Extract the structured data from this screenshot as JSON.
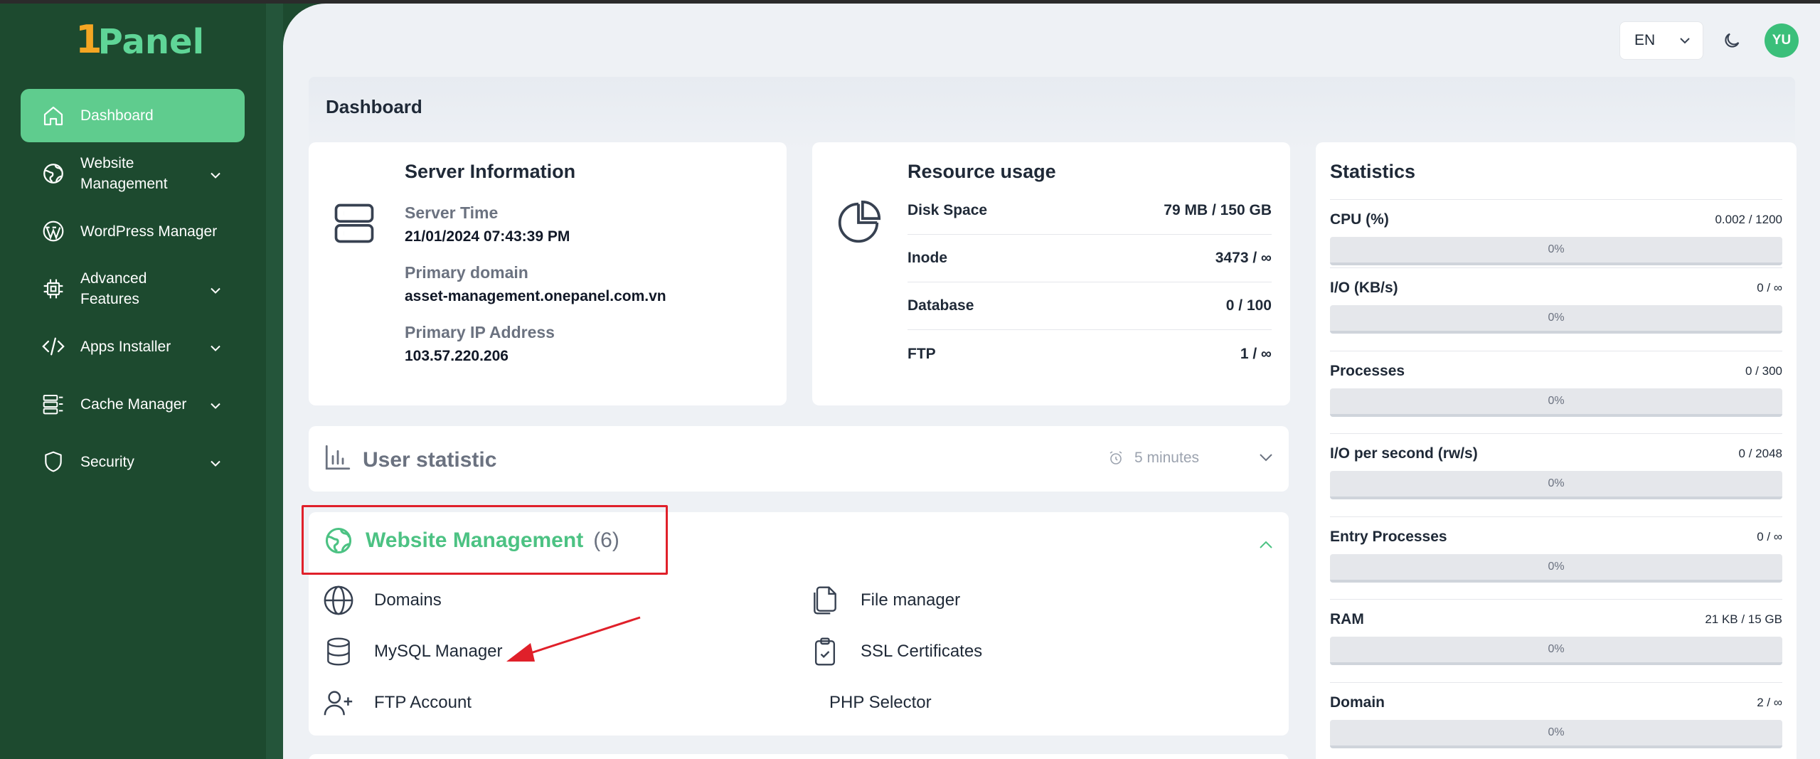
{
  "brand": {
    "one": "1",
    "name": "Panel",
    "accent": "#f5a623",
    "green": "#5fd597"
  },
  "sidebar": {
    "items": [
      {
        "label": "Dashboard",
        "icon": "home-icon",
        "active": true
      },
      {
        "label": "Website Management",
        "icon": "globe-leaf-icon",
        "expandable": true
      },
      {
        "label": "WordPress Manager",
        "icon": "wordpress-icon"
      },
      {
        "label": "Advanced Features",
        "icon": "chip-icon",
        "expandable": true
      },
      {
        "label": "Apps Installer",
        "icon": "code-icon",
        "expandable": true
      },
      {
        "label": "Cache Manager",
        "icon": "cache-icon",
        "expandable": true
      },
      {
        "label": "Security",
        "icon": "shield-icon",
        "expandable": true
      }
    ]
  },
  "topbar": {
    "language": "EN",
    "avatar_initials": "YU"
  },
  "page": {
    "title": "Dashboard"
  },
  "server_info": {
    "title": "Server Information",
    "server_time_label": "Server Time",
    "server_time": "21/01/2024 07:43:39 PM",
    "primary_domain_label": "Primary domain",
    "primary_domain": "asset-management.onepanel.com.vn",
    "primary_ip_label": "Primary IP Address",
    "primary_ip": "103.57.220.206"
  },
  "resource_usage": {
    "title": "Resource usage",
    "rows": [
      {
        "label": "Disk Space",
        "value": "79 MB / 150 GB"
      },
      {
        "label": "Inode",
        "value": "3473 / ∞"
      },
      {
        "label": "Database",
        "value": "0 / 100"
      },
      {
        "label": "FTP",
        "value": "1 / ∞"
      }
    ]
  },
  "statistics": {
    "title": "Statistics",
    "items": [
      {
        "name": "CPU (%)",
        "value": "0.002 / 1200",
        "percent_label": "0%",
        "percent": 0
      },
      {
        "name": "I/O (KB/s)",
        "value": "0 / ∞",
        "percent_label": "0%",
        "percent": 0
      },
      {
        "name": "Processes",
        "value": "0 / 300",
        "percent_label": "0%",
        "percent": 0
      },
      {
        "name": "I/O per second (rw/s)",
        "value": "0 / 2048",
        "percent_label": "0%",
        "percent": 0
      },
      {
        "name": "Entry Processes",
        "value": "0 / ∞",
        "percent_label": "0%",
        "percent": 0
      },
      {
        "name": "RAM",
        "value": "21 KB / 15 GB",
        "percent_label": "0%",
        "percent": 0
      },
      {
        "name": "Domain",
        "value": "2 / ∞",
        "percent_label": "0%",
        "percent": 0
      }
    ]
  },
  "user_statistic": {
    "title": "User statistic",
    "interval": "5 minutes"
  },
  "website_management": {
    "title": "Website Management",
    "count": "(6)",
    "items": [
      {
        "label": "Domains",
        "icon": "globe-icon"
      },
      {
        "label": "File manager",
        "icon": "files-icon"
      },
      {
        "label": "MySQL Manager",
        "icon": "database-icon"
      },
      {
        "label": "SSL Certificates",
        "icon": "clipboard-check-icon"
      },
      {
        "label": "FTP Account",
        "icon": "user-plus-icon"
      },
      {
        "label": "PHP Selector",
        "icon": ""
      }
    ]
  },
  "colors": {
    "sidebar_bg": "#1d4a2f",
    "active": "#5fcc8e",
    "highlight": "#e0202a",
    "main_bg": "#eef1f5"
  }
}
